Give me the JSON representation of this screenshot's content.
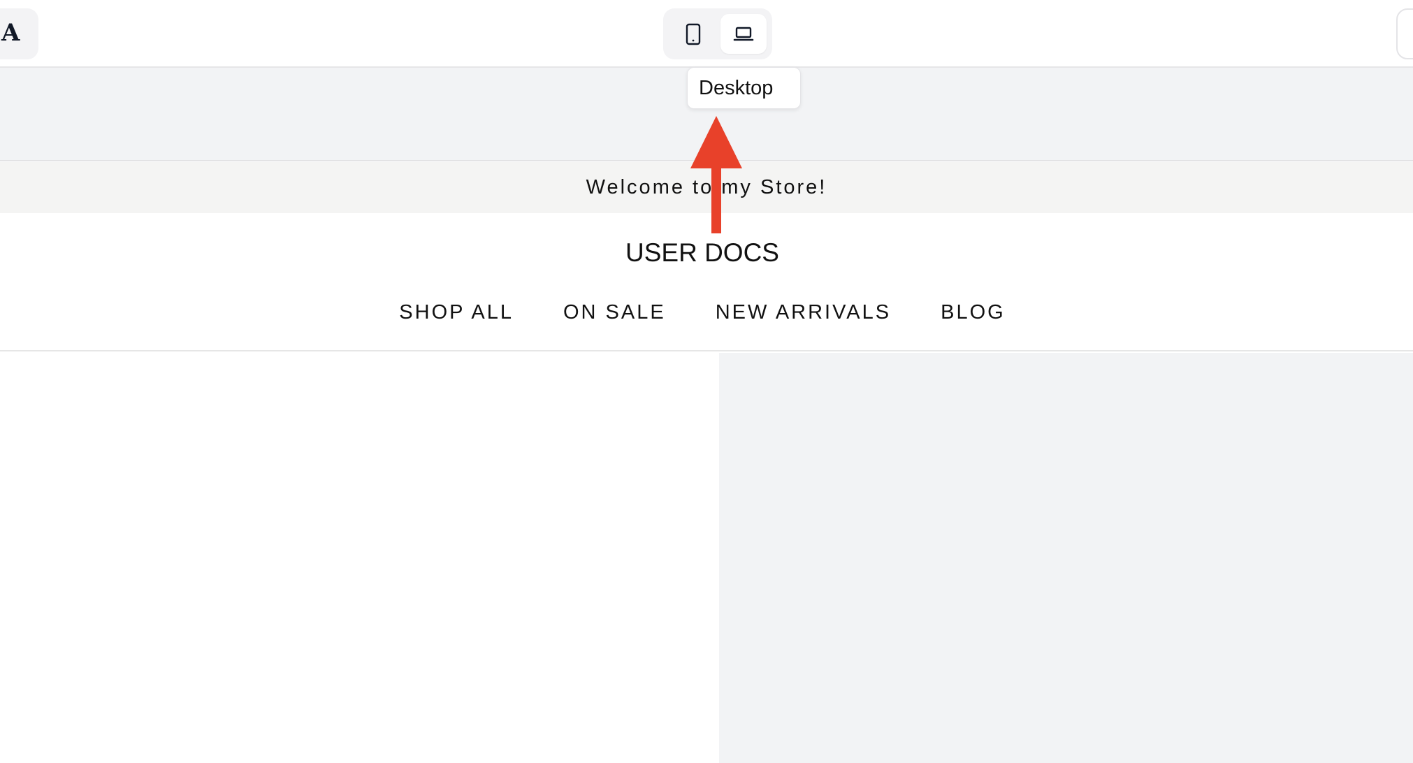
{
  "toolbar": {
    "logo_glyph": "A",
    "device_toggle": {
      "mobile": "mobile-device",
      "desktop": "desktop-device",
      "selected": "desktop"
    }
  },
  "tooltip": {
    "label": "Desktop"
  },
  "store": {
    "announcement": "Welcome to my Store!",
    "name": "USER DOCS",
    "nav": [
      "SHOP ALL",
      "ON SALE",
      "NEW ARRIVALS",
      "BLOG"
    ]
  },
  "colors": {
    "annotation_arrow": "#e8412a",
    "preview_bg": "#f2f3f5",
    "announcement_bg": "#f4f4f3"
  },
  "icons": {
    "mobile": "smartphone-icon",
    "desktop": "laptop-icon"
  }
}
